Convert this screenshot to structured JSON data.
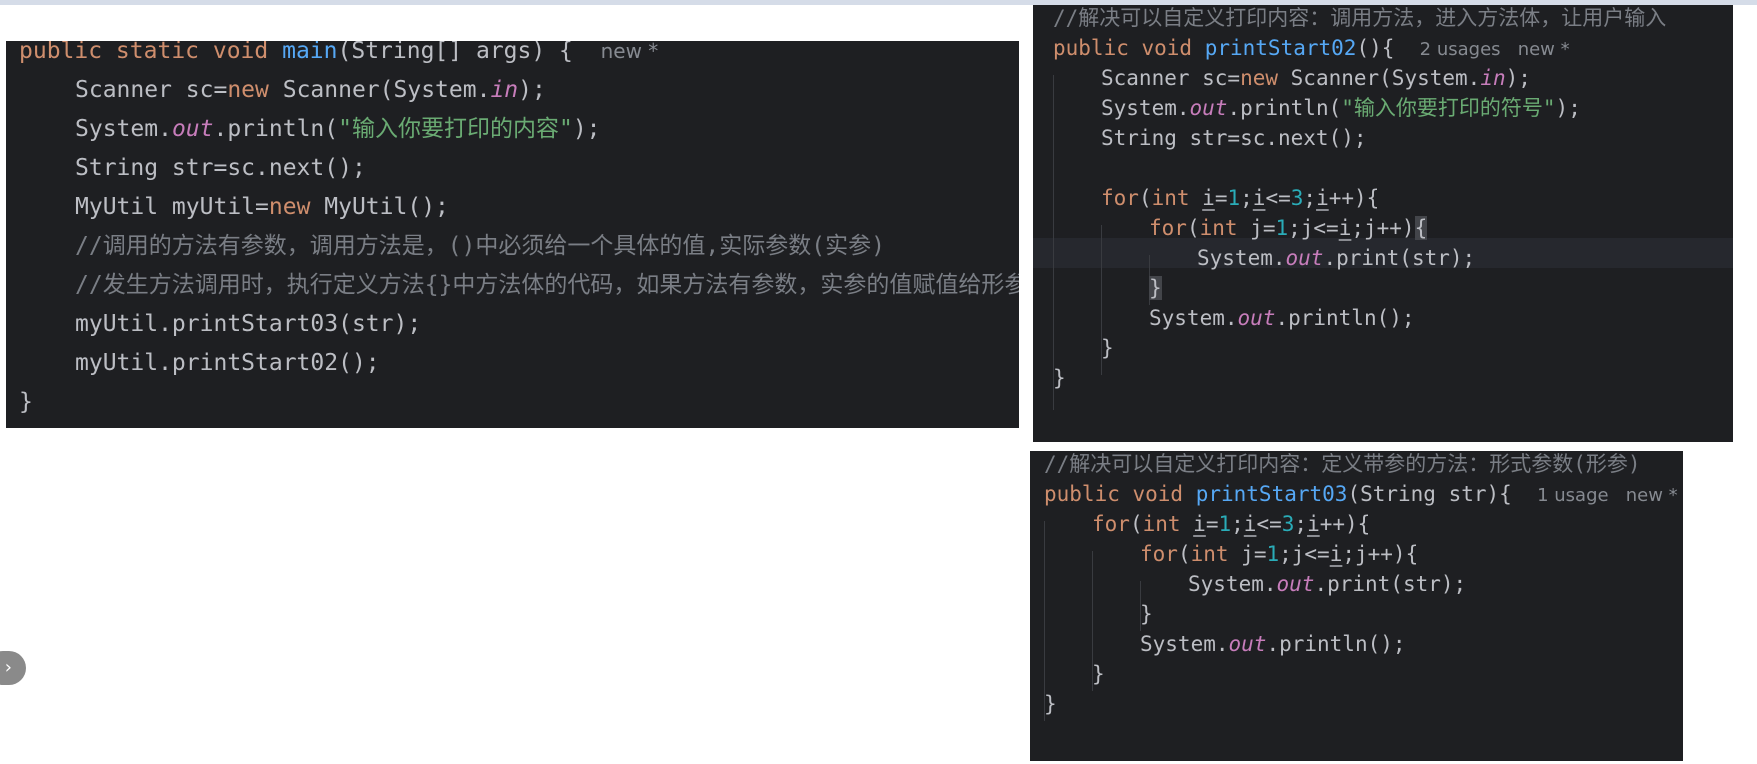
{
  "main_method": {
    "lines": [
      {
        "parts": [
          {
            "t": "public static void ",
            "c": "kw"
          },
          {
            "t": "main",
            "c": "fn"
          },
          {
            "t": "(String[] args) {  "
          },
          {
            "t": "new *",
            "c": "hint"
          }
        ]
      },
      {
        "indent": 1,
        "parts": [
          {
            "t": "Scanner sc="
          },
          {
            "t": "new ",
            "c": "kw"
          },
          {
            "t": "Scanner(System."
          },
          {
            "t": "in",
            "c": "field"
          },
          {
            "t": ");"
          }
        ]
      },
      {
        "indent": 1,
        "parts": [
          {
            "t": "System."
          },
          {
            "t": "out",
            "c": "field"
          },
          {
            "t": ".println("
          },
          {
            "t": "\"输入你要打印的内容\"",
            "c": "str"
          },
          {
            "t": ");"
          }
        ]
      },
      {
        "indent": 1,
        "parts": [
          {
            "t": "String str=sc.next();"
          }
        ]
      },
      {
        "indent": 1,
        "parts": [
          {
            "t": "MyUtil myUtil="
          },
          {
            "t": "new ",
            "c": "kw"
          },
          {
            "t": "MyUtil();"
          }
        ]
      },
      {
        "indent": 1,
        "parts": [
          {
            "t": "//调用的方法有参数，调用方法是，()中必须给一个具体的值,实际参数(实参)",
            "c": "cmt"
          }
        ]
      },
      {
        "indent": 1,
        "parts": [
          {
            "t": "//发生方法调用时，执行定义方法{}中方法体的代码，如果方法有参数，实参的值赋值给形参",
            "c": "cmt"
          }
        ]
      },
      {
        "indent": 1,
        "parts": [
          {
            "t": "myUtil.printStart03(str);"
          }
        ]
      },
      {
        "indent": 1,
        "parts": [
          {
            "t": "myUtil.printStart02();"
          }
        ]
      },
      {
        "parts": [
          {
            "t": "}"
          }
        ]
      }
    ]
  },
  "print_start_02": {
    "lines": [
      {
        "parts": [
          {
            "t": "//解决可以自定义打印内容：调用方法，进入方法体，让用户输入",
            "c": "cmt"
          }
        ]
      },
      {
        "parts": [
          {
            "t": "public void ",
            "c": "kw"
          },
          {
            "t": "printStart02",
            "c": "fn"
          },
          {
            "t": "(){  "
          },
          {
            "t": "2 usages   new *",
            "c": "hint"
          }
        ]
      },
      {
        "indent": 1,
        "parts": [
          {
            "t": "Scanner sc="
          },
          {
            "t": "new ",
            "c": "kw"
          },
          {
            "t": "Scanner(System."
          },
          {
            "t": "in",
            "c": "field"
          },
          {
            "t": ");"
          }
        ]
      },
      {
        "indent": 1,
        "parts": [
          {
            "t": "System."
          },
          {
            "t": "out",
            "c": "field"
          },
          {
            "t": ".println("
          },
          {
            "t": "\"输入你要打印的符号\"",
            "c": "str"
          },
          {
            "t": ");"
          }
        ]
      },
      {
        "indent": 1,
        "parts": [
          {
            "t": "String str=sc.next();"
          }
        ]
      },
      {
        "parts": []
      },
      {
        "indent": 1,
        "parts": [
          {
            "t": "for",
            "c": "kw"
          },
          {
            "t": "("
          },
          {
            "t": "int ",
            "c": "kw"
          },
          {
            "t": "i",
            "c": "under"
          },
          {
            "t": "="
          },
          {
            "t": "1",
            "c": "num"
          },
          {
            "t": ";"
          },
          {
            "t": "i",
            "c": "under"
          },
          {
            "t": "<="
          },
          {
            "t": "3",
            "c": "num"
          },
          {
            "t": ";"
          },
          {
            "t": "i",
            "c": "under"
          },
          {
            "t": "++){"
          }
        ]
      },
      {
        "indent": 2,
        "parts": [
          {
            "t": "for",
            "c": "kw"
          },
          {
            "t": "("
          },
          {
            "t": "int ",
            "c": "kw"
          },
          {
            "t": "j="
          },
          {
            "t": "1",
            "c": "num"
          },
          {
            "t": ";j<="
          },
          {
            "t": "i",
            "c": "under"
          },
          {
            "t": ";j++)"
          },
          {
            "t": "{",
            "c": "brace-hl"
          }
        ]
      },
      {
        "indent": 3,
        "parts": [
          {
            "t": "System."
          },
          {
            "t": "out",
            "c": "field"
          },
          {
            "t": ".print(str);"
          }
        ]
      },
      {
        "indent": 2,
        "parts": [
          {
            "t": "}",
            "c": "brace-hl"
          }
        ]
      },
      {
        "indent": 2,
        "parts": [
          {
            "t": "System."
          },
          {
            "t": "out",
            "c": "field"
          },
          {
            "t": ".println();"
          }
        ]
      },
      {
        "indent": 1,
        "parts": [
          {
            "t": "}"
          }
        ]
      },
      {
        "parts": [
          {
            "t": "}"
          }
        ]
      }
    ]
  },
  "print_start_03": {
    "lines": [
      {
        "parts": [
          {
            "t": "//解决可以自定义打印内容：定义带参的方法：形式参数(形参)",
            "c": "cmt"
          }
        ]
      },
      {
        "parts": [
          {
            "t": "public void ",
            "c": "kw"
          },
          {
            "t": "printStart03",
            "c": "fn"
          },
          {
            "t": "(String str){  "
          },
          {
            "t": "1 usage   new *",
            "c": "hint"
          }
        ]
      },
      {
        "indent": 1,
        "parts": [
          {
            "t": "for",
            "c": "kw"
          },
          {
            "t": "("
          },
          {
            "t": "int ",
            "c": "kw"
          },
          {
            "t": "i",
            "c": "under"
          },
          {
            "t": "="
          },
          {
            "t": "1",
            "c": "num"
          },
          {
            "t": ";"
          },
          {
            "t": "i",
            "c": "under"
          },
          {
            "t": "<="
          },
          {
            "t": "3",
            "c": "num"
          },
          {
            "t": ";"
          },
          {
            "t": "i",
            "c": "under"
          },
          {
            "t": "++){"
          }
        ]
      },
      {
        "indent": 2,
        "parts": [
          {
            "t": "for",
            "c": "kw"
          },
          {
            "t": "("
          },
          {
            "t": "int ",
            "c": "kw"
          },
          {
            "t": "j="
          },
          {
            "t": "1",
            "c": "num"
          },
          {
            "t": ";j<="
          },
          {
            "t": "i",
            "c": "under"
          },
          {
            "t": ";j++){"
          }
        ]
      },
      {
        "indent": 3,
        "parts": [
          {
            "t": "System."
          },
          {
            "t": "out",
            "c": "field"
          },
          {
            "t": ".print(str);"
          }
        ]
      },
      {
        "indent": 2,
        "parts": [
          {
            "t": "}"
          }
        ]
      },
      {
        "indent": 2,
        "parts": [
          {
            "t": "System."
          },
          {
            "t": "out",
            "c": "field"
          },
          {
            "t": ".println();"
          }
        ]
      },
      {
        "indent": 1,
        "parts": [
          {
            "t": "}"
          }
        ]
      },
      {
        "parts": [
          {
            "t": "}"
          }
        ]
      }
    ]
  },
  "sidebar_toggle": {
    "icon": "chevron-right-icon",
    "glyph": "›"
  },
  "colors": {
    "editor_background": "#1e1f22",
    "keyword": "#cf8e6d",
    "method_name": "#56a8f5",
    "static_field": "#c77dbb",
    "string": "#6aab73",
    "number": "#2aacb8",
    "comment": "#7a7e85",
    "plain_text": "#bcbec4"
  }
}
